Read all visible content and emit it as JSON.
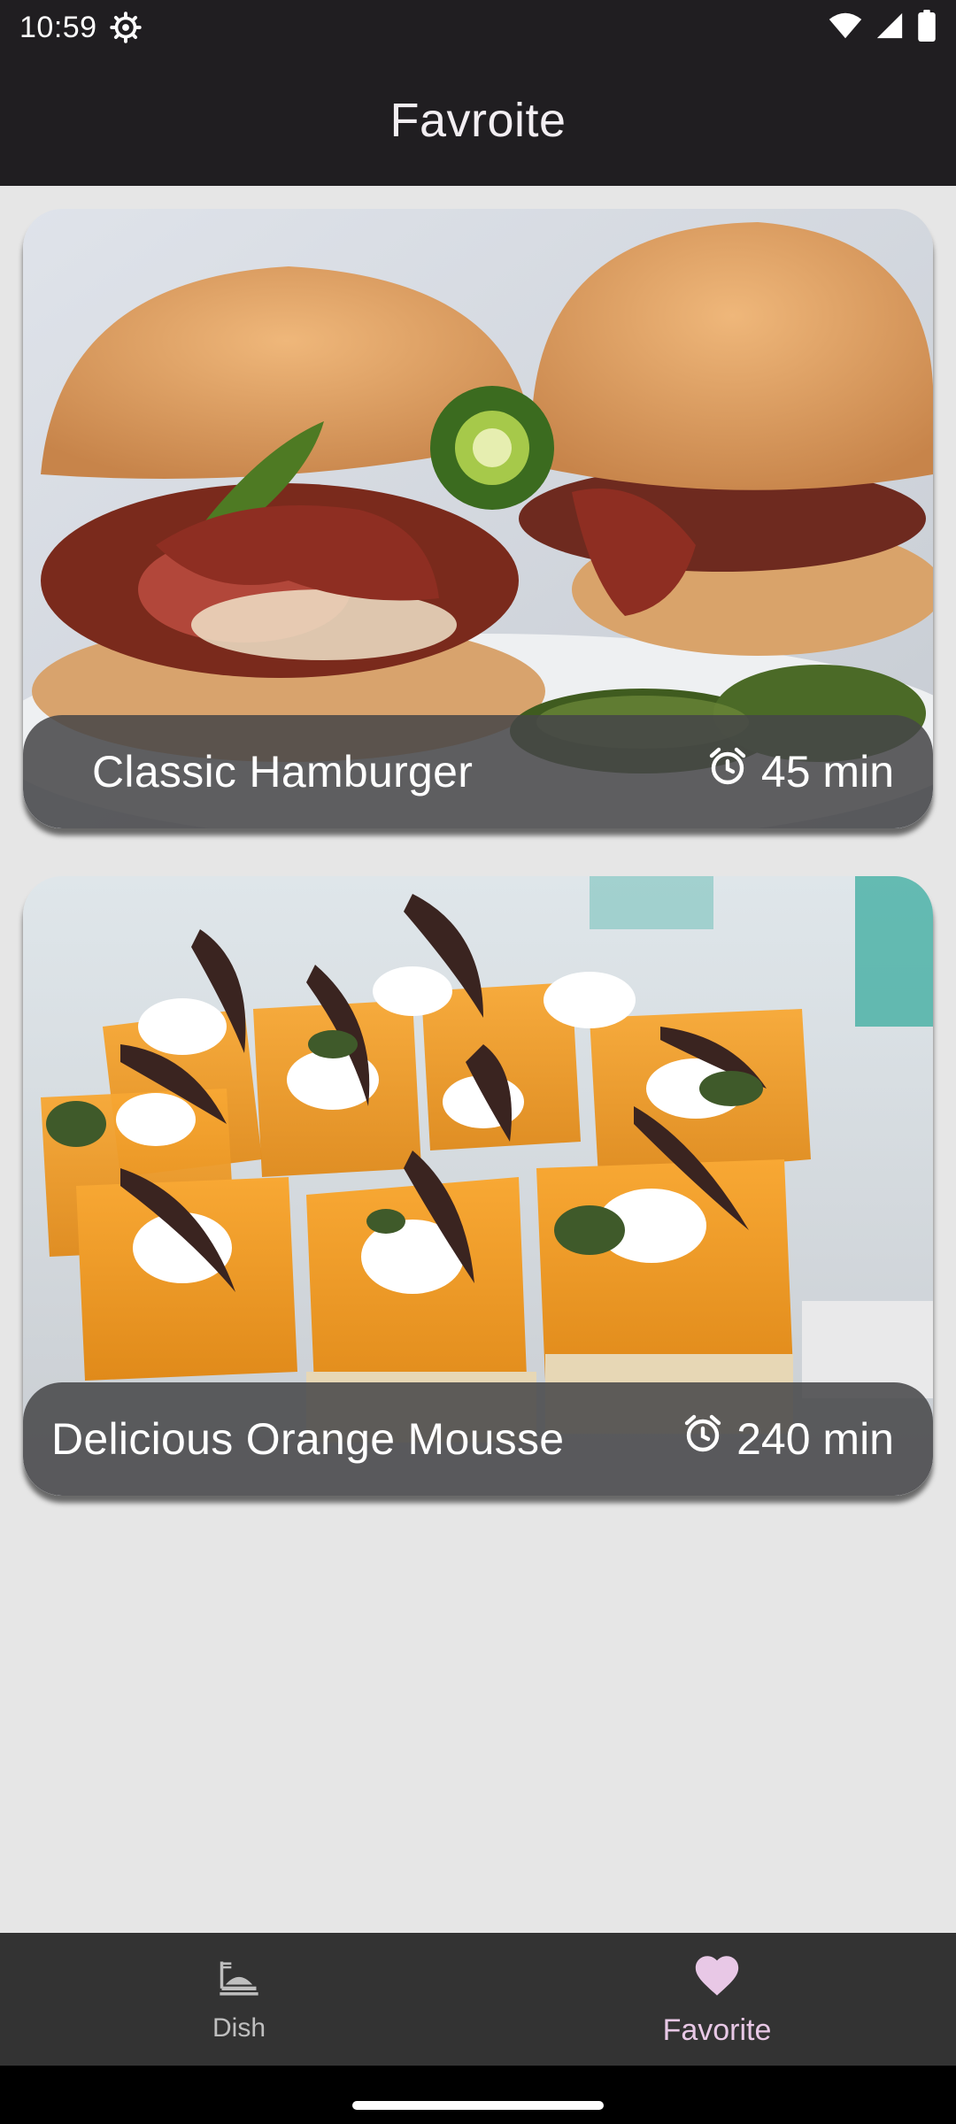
{
  "status_bar": {
    "time": "10:59",
    "icons": [
      "settings-gear-icon",
      "wifi-icon",
      "cellular-signal-icon",
      "battery-icon"
    ]
  },
  "app_bar": {
    "title": "Favroite"
  },
  "meals": [
    {
      "title": "Classic Hamburger",
      "duration": "45 min",
      "image_icon": "hamburger-image",
      "duration_icon": "alarm-clock-icon"
    },
    {
      "title": "Delicious Orange Mousse",
      "duration": "240 min",
      "image_icon": "orange-mousse-image",
      "duration_icon": "alarm-clock-icon"
    }
  ],
  "bottom_nav": {
    "items": [
      {
        "label": "Dish",
        "icon": "dish-icon",
        "selected": false
      },
      {
        "label": "Favorite",
        "icon": "heart-icon",
        "selected": true
      }
    ]
  },
  "colors": {
    "app_bar_bg": "#201e21",
    "content_bg": "#e6e6e6",
    "nav_bg": "#333333",
    "nav_selected": "#e8c8e6",
    "nav_unselected": "#bfbfbf"
  }
}
